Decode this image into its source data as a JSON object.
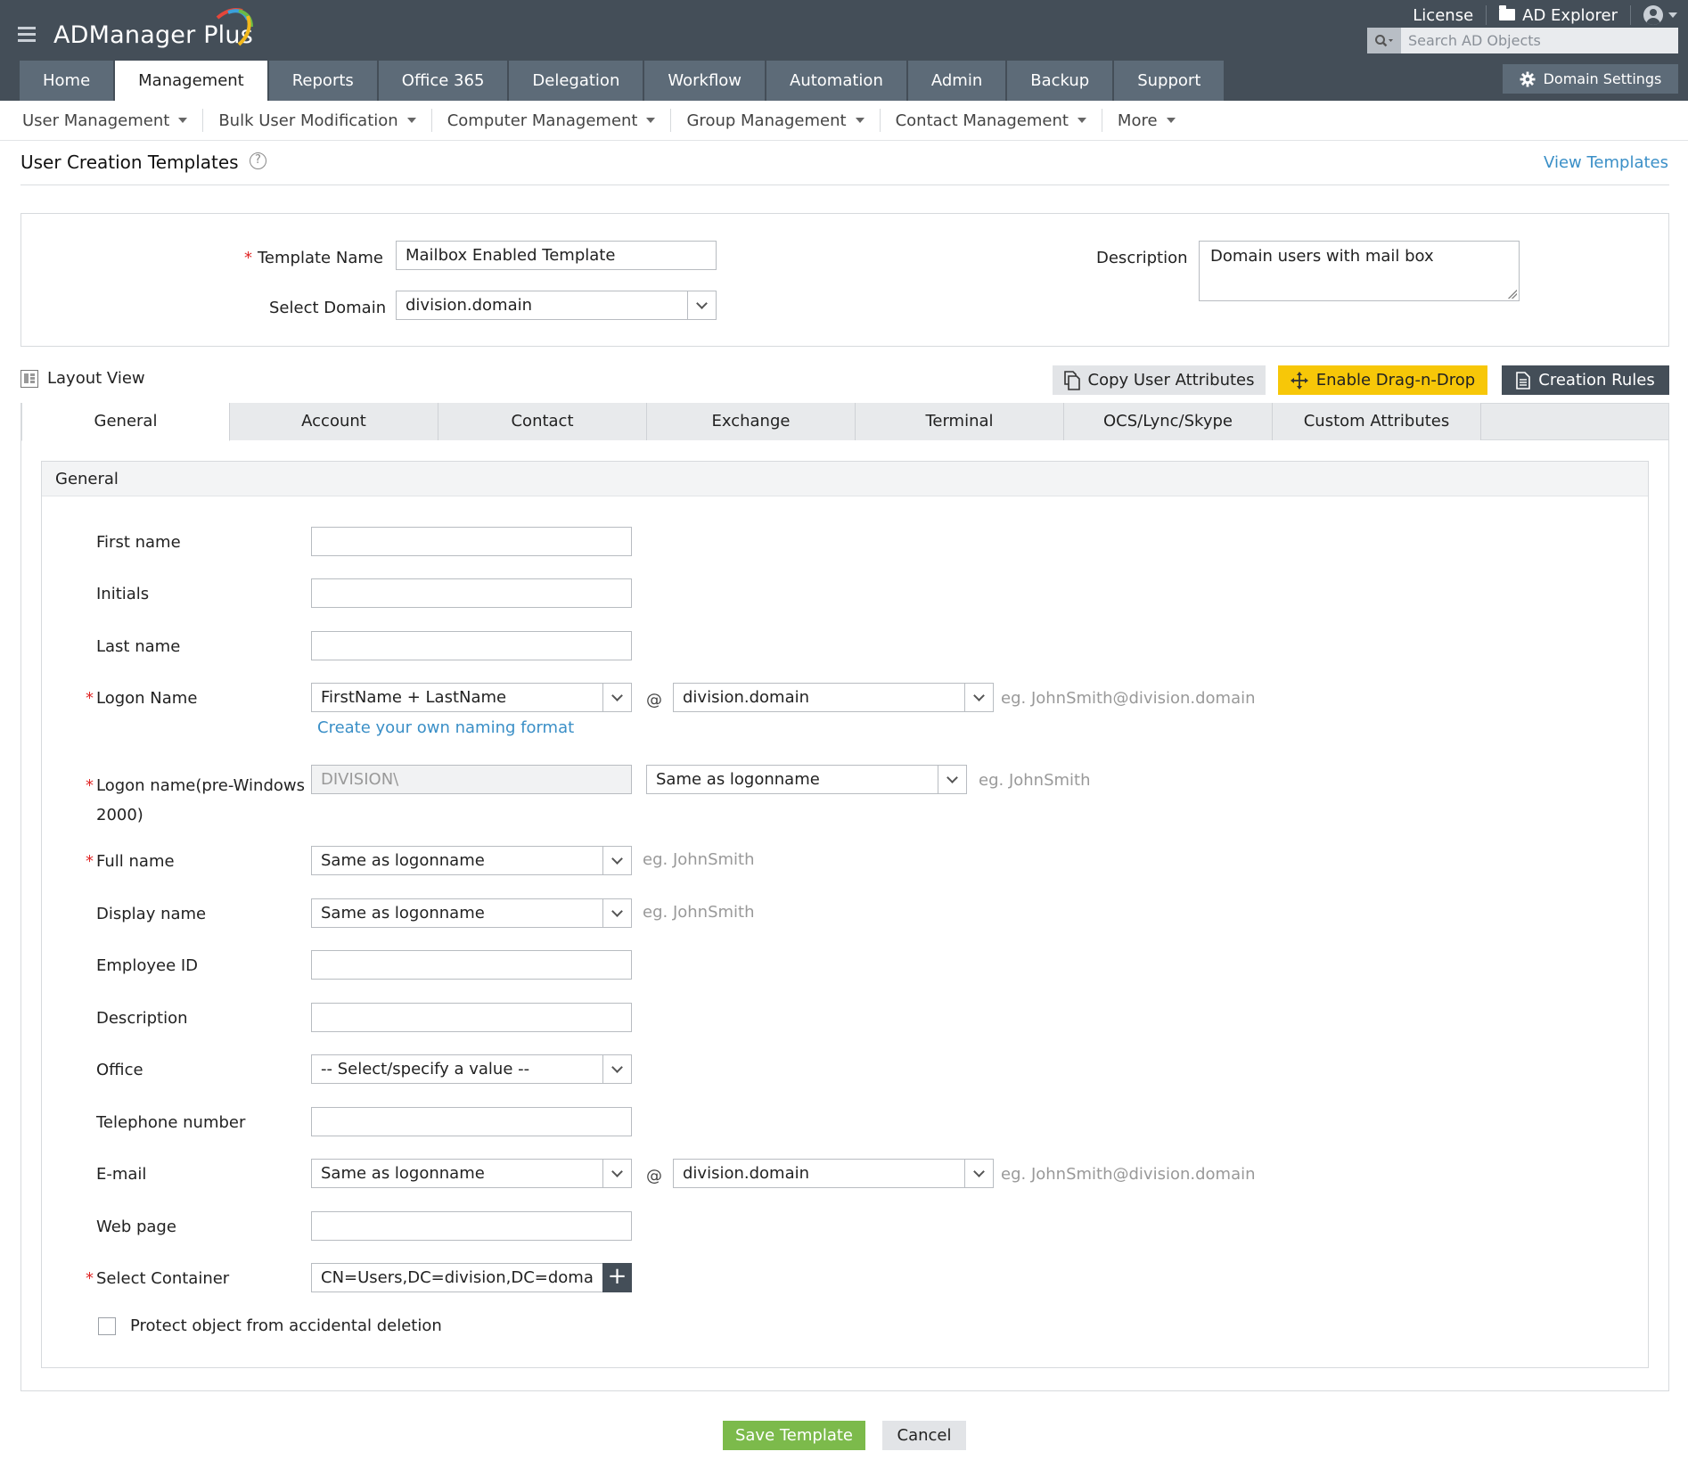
{
  "app": {
    "logo_text": "ADManager Plus",
    "top_links": {
      "license": "License",
      "ad_explorer": "AD Explorer"
    },
    "search": {
      "placeholder": "Search AD Objects",
      "value": ""
    },
    "domain_settings": "Domain Settings",
    "colors": {
      "header": "#444e58",
      "tab": "#5d6b78",
      "accent_link": "#3a8fc7",
      "drag_button": "#f7c708",
      "save_button": "#7cba4b",
      "required": "#e02727"
    }
  },
  "main_nav": [
    {
      "label": "Home",
      "active": false
    },
    {
      "label": "Management",
      "active": true
    },
    {
      "label": "Reports",
      "active": false
    },
    {
      "label": "Office 365",
      "active": false
    },
    {
      "label": "Delegation",
      "active": false
    },
    {
      "label": "Workflow",
      "active": false
    },
    {
      "label": "Automation",
      "active": false
    },
    {
      "label": "Admin",
      "active": false
    },
    {
      "label": "Backup",
      "active": false
    },
    {
      "label": "Support",
      "active": false
    }
  ],
  "sub_nav": [
    {
      "label": "User Management"
    },
    {
      "label": "Bulk User Modification"
    },
    {
      "label": "Computer Management"
    },
    {
      "label": "Group Management"
    },
    {
      "label": "Contact Management"
    },
    {
      "label": "More"
    }
  ],
  "page": {
    "title": "User Creation Templates",
    "help_glyph": "?",
    "view_templates": "View Templates"
  },
  "template_info": {
    "template_name_label": "Template Name",
    "template_name_value": "Mailbox Enabled Template",
    "select_domain_label": "Select Domain",
    "select_domain_value": "division.domain",
    "description_label": "Description",
    "description_value": "Domain users with mail box"
  },
  "toolbar": {
    "layout_view": "Layout View",
    "copy_attributes": "Copy User Attributes",
    "enable_drag": "Enable Drag-n-Drop",
    "creation_rules": "Creation Rules"
  },
  "tabs": [
    {
      "label": "General",
      "active": true
    },
    {
      "label": "Account",
      "active": false
    },
    {
      "label": "Contact",
      "active": false
    },
    {
      "label": "Exchange",
      "active": false
    },
    {
      "label": "Terminal",
      "active": false
    },
    {
      "label": "OCS/Lync/Skype",
      "active": false
    },
    {
      "label": "Custom Attributes",
      "active": false
    }
  ],
  "general": {
    "panel_title": "General",
    "required_mark": "*",
    "at_sign": "@",
    "first_name": {
      "label": "First name",
      "value": ""
    },
    "initials": {
      "label": "Initials",
      "value": ""
    },
    "last_name": {
      "label": "Last name",
      "value": ""
    },
    "logon_name": {
      "label": "Logon Name",
      "format_value": "FirstName + LastName",
      "domain_value": "division.domain",
      "hint": "eg. JohnSmith@division.domain",
      "naming_link": "Create your own naming format"
    },
    "pre_windows": {
      "label_line1": "Logon name(pre-Windows",
      "label_line2": "2000)",
      "prefix_value": "DIVISION\\",
      "format_value": "Same as logonname",
      "hint": "eg. JohnSmith"
    },
    "full_name": {
      "label": "Full name",
      "value": "Same as logonname",
      "hint": "eg. JohnSmith"
    },
    "display_name": {
      "label": "Display name",
      "value": "Same as logonname",
      "hint": "eg. JohnSmith"
    },
    "employee_id": {
      "label": "Employee ID",
      "value": ""
    },
    "description": {
      "label": "Description",
      "value": ""
    },
    "office": {
      "label": "Office",
      "value": "-- Select/specify a value --"
    },
    "telephone": {
      "label": "Telephone number",
      "value": ""
    },
    "email": {
      "label": "E-mail",
      "format_value": "Same as logonname",
      "domain_value": "division.domain",
      "hint": "eg. JohnSmith@division.domain"
    },
    "web_page": {
      "label": "Web page",
      "value": ""
    },
    "container": {
      "label": "Select Container",
      "value": "CN=Users,DC=division,DC=domain",
      "add_glyph": "+"
    },
    "protect": {
      "label": "Protect object from accidental deletion",
      "checked": false
    }
  },
  "footer": {
    "save": "Save Template",
    "cancel": "Cancel"
  },
  "icons": {
    "menu": "hamburger-icon",
    "folder": "folder-icon",
    "user": "user-icon",
    "search": "search-icon",
    "gear": "gear-icon",
    "help": "help-icon",
    "copy": "copy-icon",
    "move": "move-icon",
    "document": "document-icon",
    "dropdown": "chevron-down-icon",
    "add": "plus-icon"
  }
}
